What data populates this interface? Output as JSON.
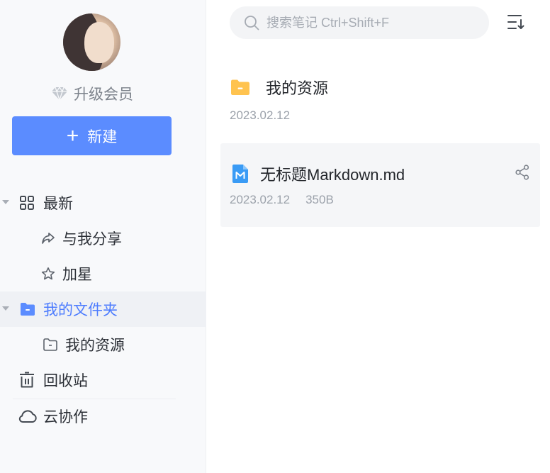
{
  "sidebar": {
    "upgrade_label": "升级会员",
    "new_label": "新建",
    "nav": {
      "recent": "最新",
      "shared": "与我分享",
      "starred": "加星",
      "my_folder": "我的文件夹",
      "my_resources": "我的资源",
      "trash": "回收站",
      "cloud": "云协作"
    }
  },
  "search": {
    "placeholder": "搜索笔记 Ctrl+Shift+F"
  },
  "files": [
    {
      "name": "我的资源",
      "type": "folder",
      "date": "2023.02.12",
      "size": ""
    },
    {
      "name": "无标题Markdown.md",
      "type": "markdown",
      "date": "2023.02.12",
      "size": "350B"
    }
  ],
  "colors": {
    "accent": "#5b8cff",
    "active_text": "#4d7cfe",
    "folder_yellow": "#ffc34f",
    "md_blue": "#3a9bf5"
  },
  "icons": {
    "vip": "diamond-icon",
    "recent": "grid-icon",
    "shared": "share-arrow-icon",
    "starred": "star-icon",
    "folder": "folder-icon",
    "trash": "trash-icon",
    "cloud": "cloud-icon",
    "search": "search-icon",
    "sort": "sort-icon",
    "share": "share-icon"
  }
}
